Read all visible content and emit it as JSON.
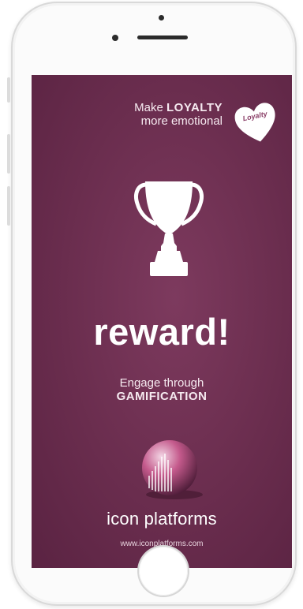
{
  "promo": {
    "tagline_make": "Make ",
    "tagline_loyalty": "LOYALTY",
    "tagline_rest": "more emotional",
    "heart_label": "Loyalty",
    "headline": "reward!",
    "engage_line": "Engage through",
    "engage_strong": "GAMIFICATION",
    "brand": "icon platforms",
    "url": "www.iconplatforms.com"
  },
  "colors": {
    "background": "#6a2d4e",
    "text": "#ffffff",
    "accent": "#c45a8c"
  },
  "icons": {
    "trophy": "trophy-icon",
    "heart": "heart-icon",
    "logo": "sphere-logo"
  }
}
